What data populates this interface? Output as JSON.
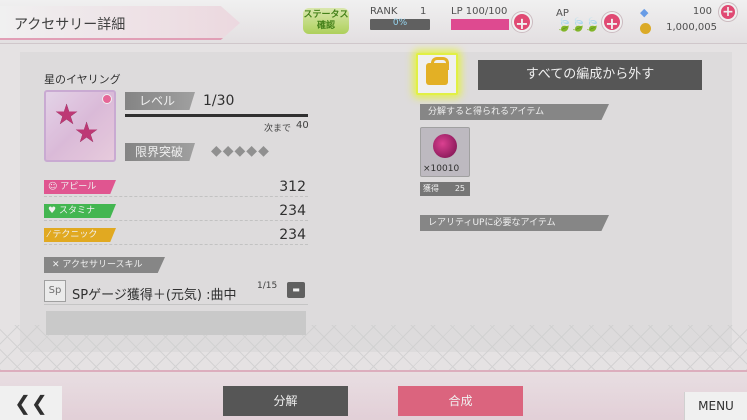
{
  "header": {
    "title": "アクセサリー詳細",
    "status_button": "ステータス確認",
    "rank_label": "RANK",
    "rank_value": "1",
    "rank_progress": "0%",
    "lp_label": "LP 100/100",
    "ap_label": "AP",
    "gems": "100",
    "gold": "1,000,005"
  },
  "accessory": {
    "name": "星のイヤリング",
    "level_label": "レベル",
    "level_value": "1/30",
    "next_label": "次まで",
    "next_value": "40",
    "limit_label": "限界突破",
    "limit_break_filled": 0,
    "limit_break_total": 5
  },
  "stats": [
    {
      "label": "アピール",
      "value": "312",
      "color": "#ef5b9a",
      "icon": "smile-icon"
    },
    {
      "label": "スタミナ",
      "value": "234",
      "color": "#48c257",
      "icon": "heart-icon"
    },
    {
      "label": "テクニック",
      "value": "234",
      "color": "#f0b424",
      "icon": "wand-icon"
    }
  ],
  "skill": {
    "section_label": "アクセサリースキル",
    "icon_text": "Sp",
    "name": "SPゲージ獲得＋(元気) :曲中",
    "count": "1/15"
  },
  "right": {
    "remove_button": "すべての編成から外す",
    "disassemble_label": "分解すると得られるアイテム",
    "item_qty": "×10010",
    "owned_label": "獲得",
    "owned_value": "25",
    "rarity_label": "レアリティUPに必要なアイテム"
  },
  "footer": {
    "back": "❮❮",
    "disassemble": "分解",
    "combine": "合成",
    "menu": "MENU"
  },
  "colors": {
    "accent_pink": "#e96b86",
    "dark_gray": "#5c5c5c",
    "highlight_yellow": "#f0ff4a"
  }
}
